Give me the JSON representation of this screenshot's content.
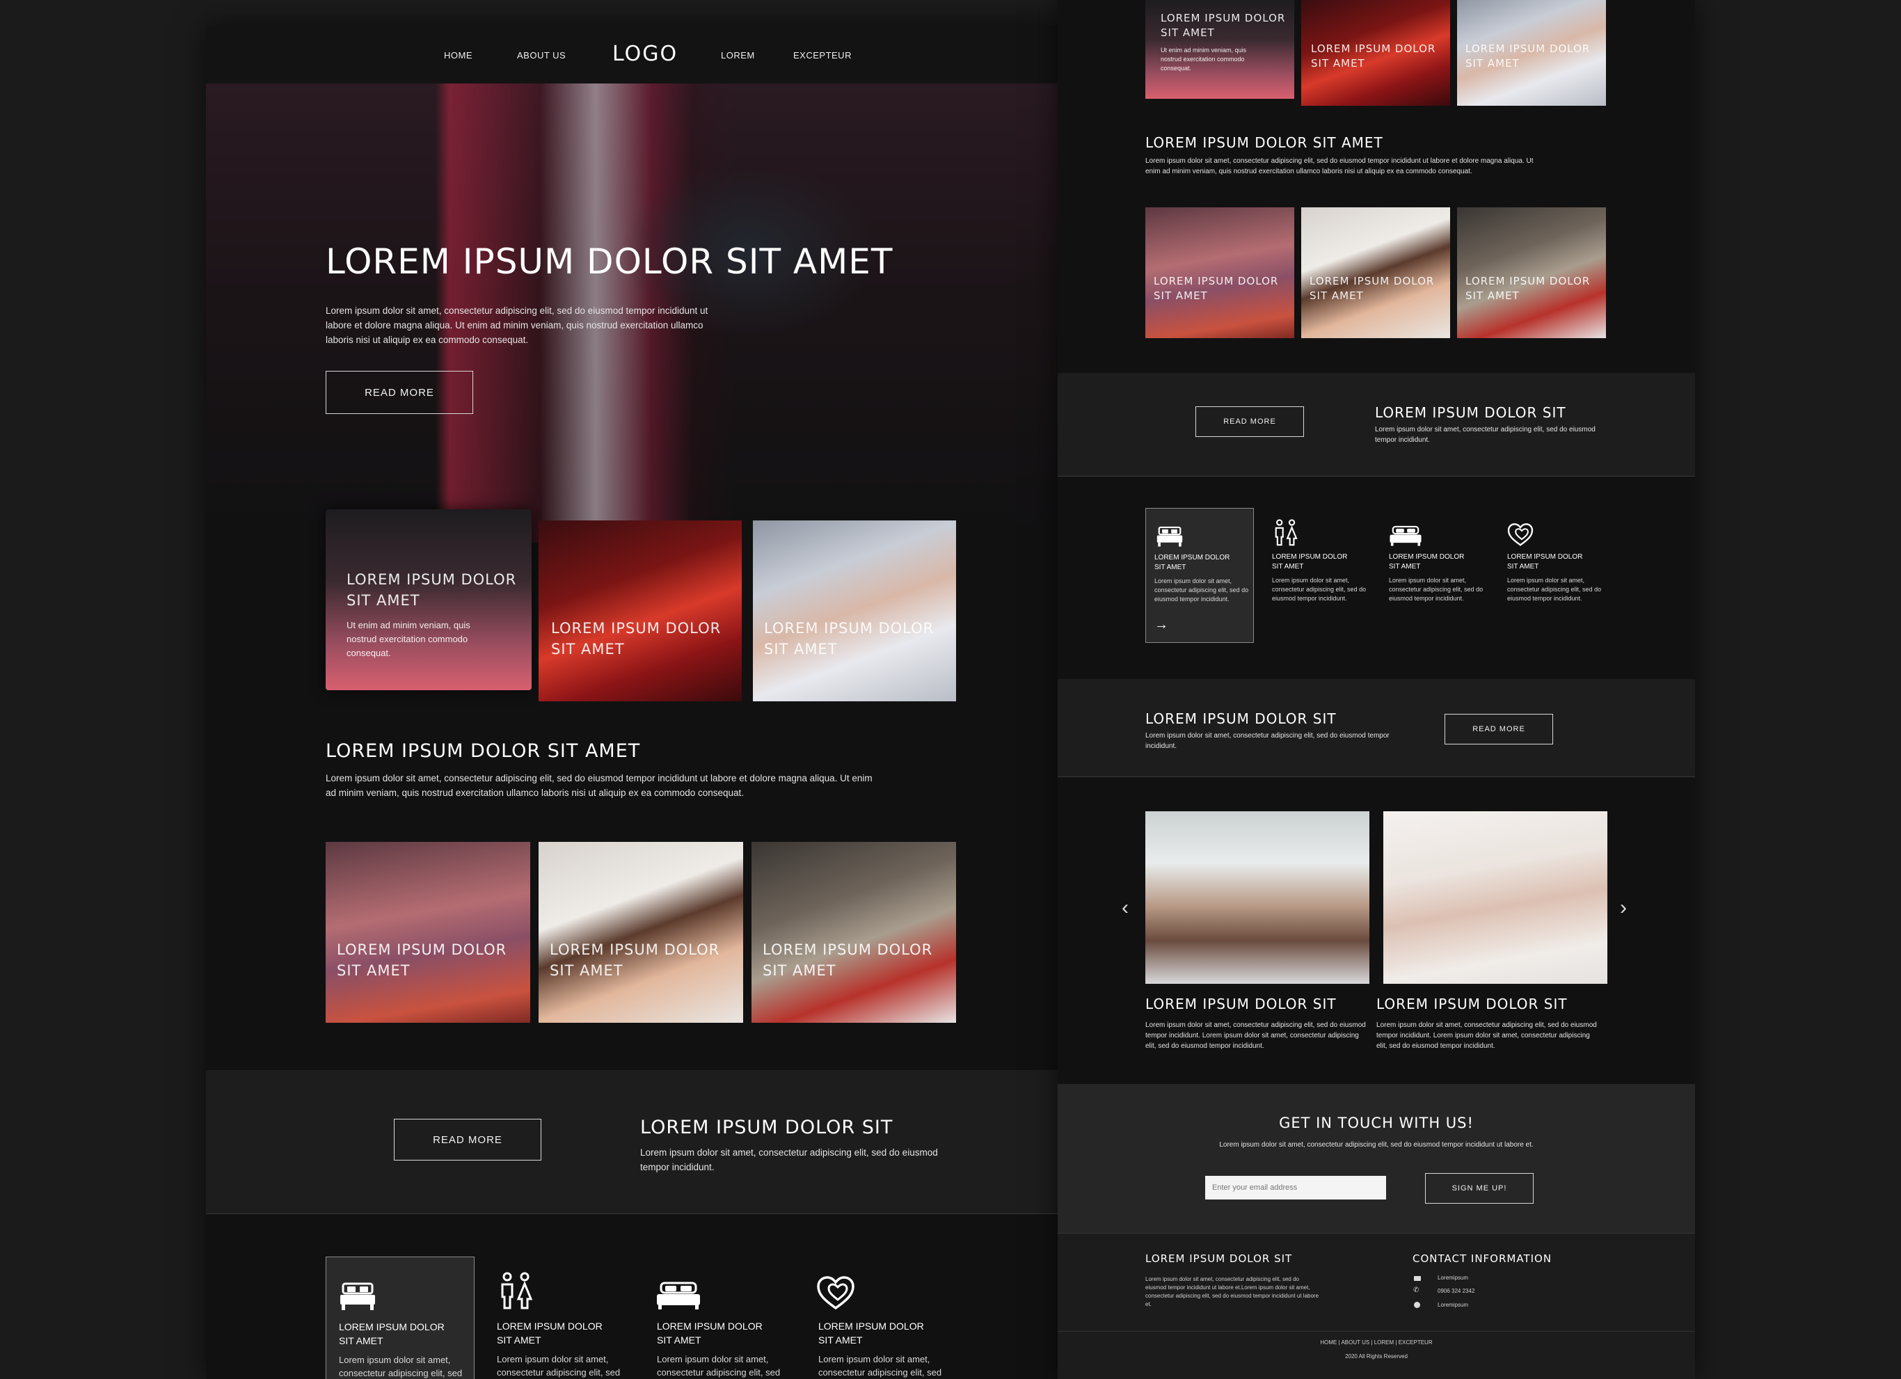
{
  "nav": {
    "home": "HOME",
    "about": "ABOUT US",
    "logo": "LOGO",
    "lorem": "LOREM",
    "excepteur": "EXCEPTEUR"
  },
  "hero": {
    "title": "LOREM IPSUM DOLOR SIT AMET",
    "text": "Lorem ipsum dolor sit amet, consectetur adipiscing elit, sed do eiusmod tempor incididunt ut labore et dolore magna aliqua. Ut enim ad minim veniam, quis nostrud exercitation ullamco laboris nisi ut aliquip ex ea commodo consequat.",
    "button": "READ MORE"
  },
  "gallery1": {
    "card_title": "LOREM IPSUM DOLOR SIT AMET",
    "card_text": "Ut enim ad minim veniam, quis nostrud exercitation commodo consequat.",
    "tile2": "LOREM IPSUM DOLOR SIT AMET",
    "tile3": "LOREM IPSUM DOLOR SIT AMET"
  },
  "section2": {
    "title": "LOREM IPSUM DOLOR SIT AMET",
    "text": "Lorem ipsum dolor sit amet, consectetur adipiscing elit, sed do eiusmod tempor incididunt ut labore et dolore magna aliqua. Ut enim ad minim veniam, quis nostrud exercitation ullamco laboris nisi ut aliquip ex ea commodo consequat."
  },
  "gallery2": {
    "tile1": "LOREM IPSUM DOLOR SIT AMET",
    "tile2": "LOREM IPSUM DOLOR SIT AMET",
    "tile3": "LOREM IPSUM DOLOR SIT AMET"
  },
  "cta1": {
    "button": "READ MORE",
    "title": "LOREM IPSUM DOLOR SIT",
    "text": "Lorem ipsum dolor sit amet, consectetur adipiscing elit, sed do eiusmod tempor incididunt."
  },
  "features": [
    {
      "icon": "bed-icon",
      "title": "LOREM IPSUM DOLOR SIT AMET",
      "text": "Lorem ipsum dolor sit amet, consectetur adipiscing elit, sed do eiusmod tempor incididunt."
    },
    {
      "icon": "couple-icon",
      "title": "LOREM IPSUM DOLOR SIT AMET",
      "text": "Lorem ipsum dolor sit amet, consectetur adipiscing elit, sed do eiusmod tempor incididunt."
    },
    {
      "icon": "double-bed-icon",
      "title": "LOREM IPSUM DOLOR SIT AMET",
      "text": "Lorem ipsum dolor sit amet, consectetur adipiscing elit, sed do eiusmod tempor incididunt."
    },
    {
      "icon": "hearts-icon",
      "title": "LOREM IPSUM DOLOR SIT AMET",
      "text": "Lorem ipsum dolor sit amet, consectetur adipiscing elit, sed do eiusmod tempor incididunt."
    }
  ],
  "cta2": {
    "title": "LOREM IPSUM DOLOR SIT",
    "text": "Lorem ipsum dolor sit amet, consectetur adipiscing elit, sed do eiusmod tempor incididunt.",
    "button": "READ MORE"
  },
  "carousel": {
    "items": [
      {
        "title": "LOREM IPSUM DOLOR SIT",
        "text": "Lorem ipsum dolor sit amet, consectetur adipiscing elit, sed do eiusmod tempor incididunt. Lorem ipsum dolor sit amet, consectetur adipiscing elit, sed do eiusmod tempor incididunt."
      },
      {
        "title": "LOREM IPSUM DOLOR SIT",
        "text": "Lorem ipsum dolor sit amet, consectetur adipiscing elit, sed do eiusmod tempor incididunt. Lorem ipsum dolor sit amet, consectetur adipiscing elit, sed do eiusmod tempor incididunt."
      }
    ]
  },
  "contact": {
    "title": "GET IN TOUCH WITH US!",
    "text": "Lorem ipsum dolor sit amet, consectetur adipiscing elit, sed do eiusmod tempor incididunt ut labore et.",
    "email_placeholder": "Enter your email address",
    "button": "SIGN ME UP!"
  },
  "footer": {
    "about_title": "LOREM IPSUM DOLOR SIT",
    "about_text": "Lorem ipsum dolor sit amet, consectetur adipiscing elit, sed do eiusmod tempor incididunt ut labore et.Lorem ipsum dolor sit amet, consectetur adipiscing elit, sed do eiusmod tempor incididunt ut labore et.",
    "contact_title": "CONTACT INFORMATION",
    "email": "Loremipsum",
    "phone": "0906 324 2342",
    "web": "Loremipsum",
    "links": "HOME | ABOUT US | LOREM | EXCEPTEUR",
    "copyright": "2020 All Rights Reserved"
  },
  "colors": {
    "background": "#1b1b1c",
    "panel": "#111112",
    "band": "#1d1d1e",
    "input": "#f4f4f4"
  }
}
